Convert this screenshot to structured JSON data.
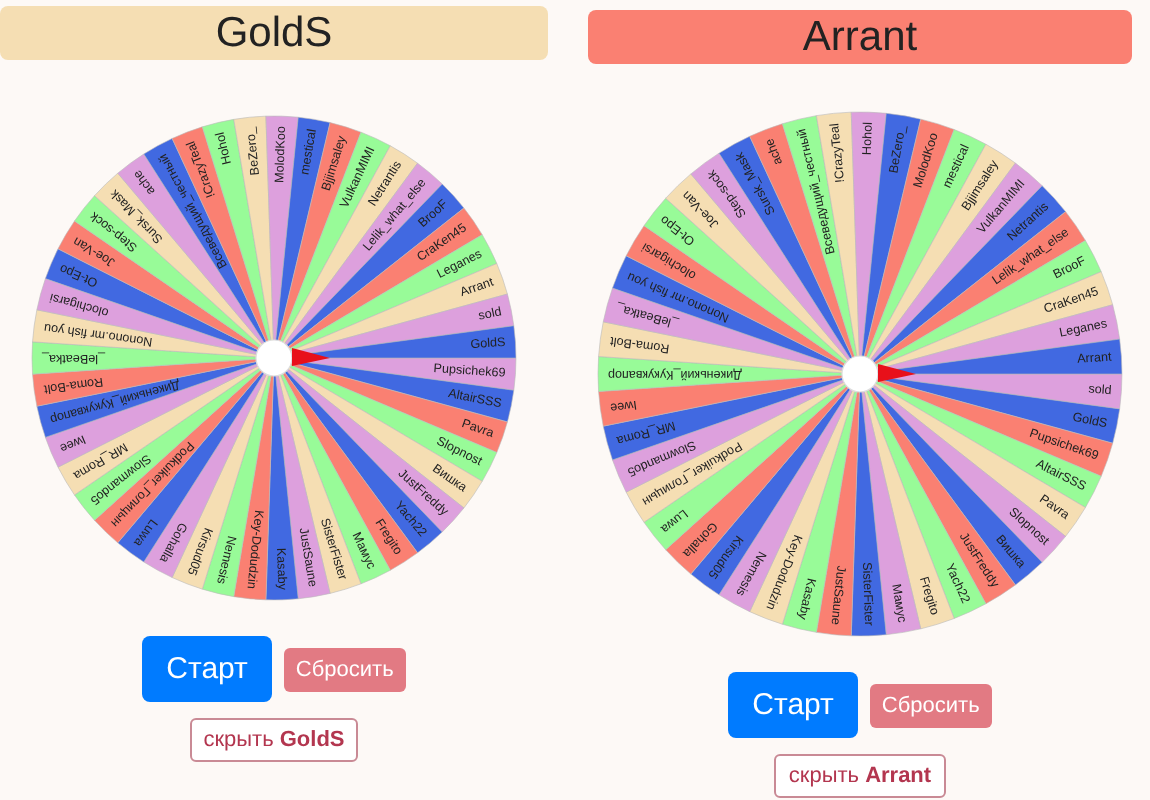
{
  "wheels": [
    {
      "title": "GoldS",
      "color": "#f5deb3",
      "segments": [
        {
          "label": "Pupsichek69"
        },
        {
          "label": "AltairSSS"
        },
        {
          "label": "Pavra"
        },
        {
          "label": "Slopnost"
        },
        {
          "label": "Вишка"
        },
        {
          "label": "JustFreddy"
        },
        {
          "label": "Yach22"
        },
        {
          "label": "Fregito"
        },
        {
          "label": "Мамус"
        },
        {
          "label": "SisterFister"
        },
        {
          "label": "JustSaune"
        },
        {
          "label": "Kasaby"
        },
        {
          "label": "Key-Dodudzin"
        },
        {
          "label": "Nemesis"
        },
        {
          "label": "Kirsud05"
        },
        {
          "label": "Gohalla"
        },
        {
          "label": "Luwa"
        },
        {
          "label": "Podkuiker_Голицын"
        },
        {
          "label": "Slowmando5"
        },
        {
          "label": "MR_Roma"
        },
        {
          "label": "Iwee"
        },
        {
          "label": "Дикенький_Кукуквапор"
        },
        {
          "label": "Roma-Bolt"
        },
        {
          "label": "_leBeatka_"
        },
        {
          "label": "Nonono.mr fish you"
        },
        {
          "label": "olochigarsi"
        },
        {
          "label": "Ot-Epo"
        },
        {
          "label": "Joe-Van"
        },
        {
          "label": "Step-sock"
        },
        {
          "label": "Sursk_Mask"
        },
        {
          "label": "ache"
        },
        {
          "label": "Всеведущий_честный"
        },
        {
          "label": "!CrazyTeal"
        },
        {
          "label": "Hohol"
        },
        {
          "label": "BeZero_"
        },
        {
          "label": "MolodKoo"
        },
        {
          "label": "mestical"
        },
        {
          "label": "Bjjimsaley"
        },
        {
          "label": "VulkanMIMI"
        },
        {
          "label": "Netrantis"
        },
        {
          "label": "Lelik_what_else"
        },
        {
          "label": "BrooF"
        },
        {
          "label": "CraKen45"
        },
        {
          "label": "Leganes"
        },
        {
          "label": "Arrant"
        },
        {
          "label": "sold"
        },
        {
          "label": "GoldS"
        }
      ],
      "start_button": "Старт",
      "reset_button": "Сбросить",
      "hide_button": "скрыть **GoldS**"
    },
    {
      "title": "Arrant",
      "color": "#fa8072",
      "segments": [
        {
          "label": "sold"
        },
        {
          "label": "GoldS"
        },
        {
          "label": "Pupsichek69"
        },
        {
          "label": "AltairSSS"
        },
        {
          "label": "Pavra"
        },
        {
          "label": "Slopnost"
        },
        {
          "label": "Вишка"
        },
        {
          "label": "JustFreddy"
        },
        {
          "label": "Yach22"
        },
        {
          "label": "Fregito"
        },
        {
          "label": "Мамус"
        },
        {
          "label": "SisterFister"
        },
        {
          "label": "JustSaune"
        },
        {
          "label": "Kasaby"
        },
        {
          "label": "Key-Dodudzin"
        },
        {
          "label": "Nemesis"
        },
        {
          "label": "Kirsud05"
        },
        {
          "label": "Gohalla"
        },
        {
          "label": "Luwa"
        },
        {
          "label": "Podkuiker_Голицын"
        },
        {
          "label": "Slowmando5"
        },
        {
          "label": "MR_Roma"
        },
        {
          "label": "Iwee"
        },
        {
          "label": "Дикенький_Кукуквапор"
        },
        {
          "label": "Roma-Bolt"
        },
        {
          "label": "_leBeatka_"
        },
        {
          "label": "Nonono.mr fish you"
        },
        {
          "label": "olochigarsi"
        },
        {
          "label": "Ot-Epo"
        },
        {
          "label": "Joe-Van"
        },
        {
          "label": "Step-sock"
        },
        {
          "label": "Sursk_Mask"
        },
        {
          "label": "ache"
        },
        {
          "label": "Всеведущий_честный"
        },
        {
          "label": "!CrazyTeal"
        },
        {
          "label": "Hohol"
        },
        {
          "label": "BeZero_"
        },
        {
          "label": "MolodKoo"
        },
        {
          "label": "mestical"
        },
        {
          "label": "Bjjimsaley"
        },
        {
          "label": "VulkanMIMI"
        },
        {
          "label": "Netrantis"
        },
        {
          "label": "Lelik_what_else"
        },
        {
          "label": "BrooF"
        },
        {
          "label": "CraKen45"
        },
        {
          "label": "Leganes"
        },
        {
          "label": "Arrant"
        }
      ],
      "start_button": "Старт",
      "reset_button": "Сбросить",
      "hide_button": "скрыть **Arrant**"
    }
  ]
}
